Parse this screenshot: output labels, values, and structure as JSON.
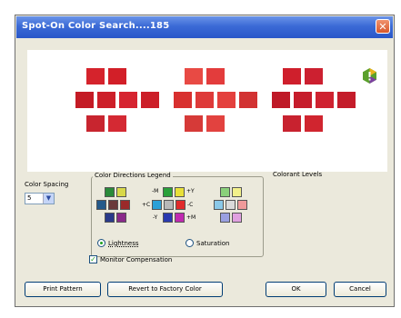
{
  "window": {
    "title": "Spot-On Color Search....185"
  },
  "colors": {
    "pattern1": [
      "#d5232c",
      "#d21f28",
      "#c41b25",
      "#cd1f29",
      "#d62430",
      "#cc1e28",
      "#c8252f",
      "#d42933"
    ],
    "pattern2": [
      "#e84a44",
      "#e33c3c",
      "#d8302f",
      "#de3a39",
      "#e4403d",
      "#d23232",
      "#d63a38",
      "#e2423f"
    ],
    "pattern3": [
      "#cf1f2c",
      "#cc2030",
      "#bf1927",
      "#c61c2b",
      "#cf2230",
      "#c41c2a",
      "#c8222f",
      "#d0252f"
    ]
  },
  "controls": {
    "color_spacing_label": "Color Spacing",
    "color_spacing_value": "5",
    "legend_title": "Color Directions Legend",
    "colorant_levels_label": "Colorant Levels",
    "direction_labels": {
      "minus_m": "-M",
      "plus_y": "+Y",
      "plus_c": "+C",
      "minus_c": "-C",
      "minus_y": "-Y",
      "plus_m": "+M"
    },
    "lightness_label": "Lightness",
    "saturation_label": "Saturation",
    "monitor_compensation_label": "Monitor Compensation"
  },
  "buttons": {
    "print_pattern": "Print Pattern",
    "revert": "Revert to Factory Color",
    "ok": "OK",
    "cancel": "Cancel"
  }
}
